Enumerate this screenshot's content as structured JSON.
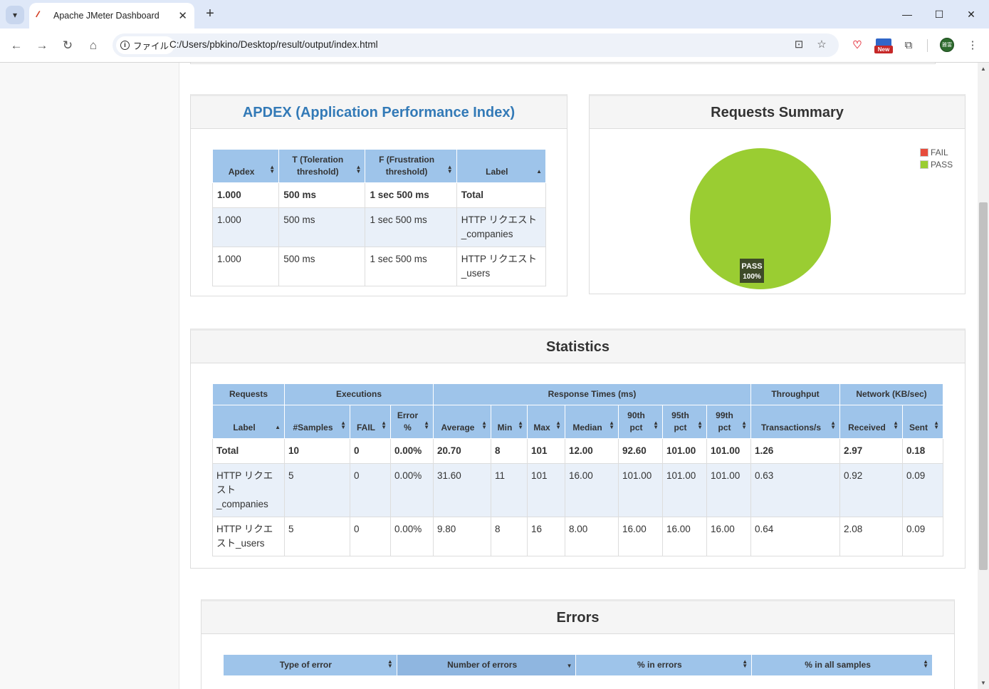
{
  "browser": {
    "tab_title": "Apache JMeter Dashboard",
    "site_info_label": "ファイル",
    "url": "C:/Users/pbkino/Desktop/result/output/index.html",
    "new_badge": "New",
    "avatar_text": "雅富"
  },
  "apdex": {
    "title": "APDEX (Application Performance Index)",
    "headers": [
      "Apdex",
      "T (Toleration threshold)",
      "F (Frustration threshold)",
      "Label"
    ],
    "rows": [
      [
        "1.000",
        "500 ms",
        "1 sec 500 ms",
        "Total"
      ],
      [
        "1.000",
        "500 ms",
        "1 sec 500 ms",
        "HTTP リクエスト_companies"
      ],
      [
        "1.000",
        "500 ms",
        "1 sec 500 ms",
        "HTTP リクエスト_users"
      ]
    ]
  },
  "requests_summary": {
    "title": "Requests Summary",
    "legend": [
      {
        "label": "FAIL",
        "color": "#e74c3c"
      },
      {
        "label": "PASS",
        "color": "#9acd32"
      }
    ],
    "pie_label_name": "PASS",
    "pie_label_pct": "100%",
    "chart_data": {
      "type": "pie",
      "categories": [
        "FAIL",
        "PASS"
      ],
      "values": [
        0,
        100
      ],
      "legend_position": "top-right"
    }
  },
  "statistics": {
    "title": "Statistics",
    "groups": [
      "Requests",
      "Executions",
      "Response Times (ms)",
      "Throughput",
      "Network (KB/sec)"
    ],
    "headers": [
      "Label",
      "#Samples",
      "FAIL",
      "Error %",
      "Average",
      "Min",
      "Max",
      "Median",
      "90th pct",
      "95th pct",
      "99th pct",
      "Transactions/s",
      "Received",
      "Sent"
    ],
    "rows": [
      [
        "Total",
        "10",
        "0",
        "0.00%",
        "20.70",
        "8",
        "101",
        "12.00",
        "92.60",
        "101.00",
        "101.00",
        "1.26",
        "2.97",
        "0.18"
      ],
      [
        "HTTP リクエスト_companies",
        "5",
        "0",
        "0.00%",
        "31.60",
        "11",
        "101",
        "16.00",
        "101.00",
        "101.00",
        "101.00",
        "0.63",
        "0.92",
        "0.09"
      ],
      [
        "HTTP リクエスト_users",
        "5",
        "0",
        "0.00%",
        "9.80",
        "8",
        "16",
        "8.00",
        "16.00",
        "16.00",
        "16.00",
        "0.64",
        "2.08",
        "0.09"
      ]
    ]
  },
  "errors": {
    "title": "Errors",
    "headers": [
      "Type of error",
      "Number of errors",
      "% in errors",
      "% in all samples"
    ]
  }
}
